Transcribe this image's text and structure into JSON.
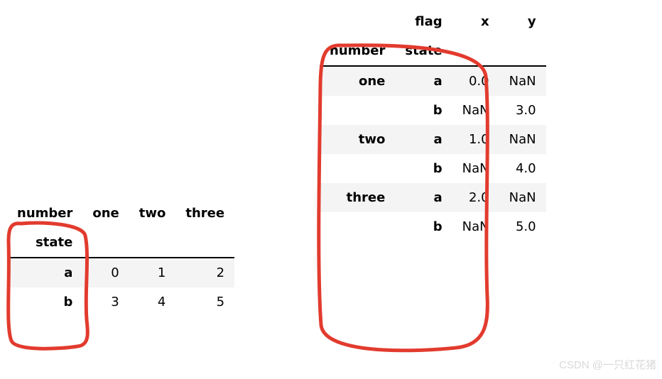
{
  "left_table": {
    "col_index_name": "number",
    "row_index_name": "state",
    "columns": [
      "one",
      "two",
      "three"
    ],
    "rows": [
      {
        "idx": "a",
        "vals": [
          "0",
          "1",
          "2"
        ]
      },
      {
        "idx": "b",
        "vals": [
          "3",
          "4",
          "5"
        ]
      }
    ]
  },
  "right_table": {
    "top_header_name": "flag",
    "columns": [
      "x",
      "y"
    ],
    "row_index_names": [
      "number",
      "state"
    ],
    "rows": [
      {
        "lvl0": "one",
        "lvl1": "a",
        "vals": [
          "0.0",
          "NaN"
        ]
      },
      {
        "lvl0": "",
        "lvl1": "b",
        "vals": [
          "NaN",
          "3.0"
        ]
      },
      {
        "lvl0": "two",
        "lvl1": "a",
        "vals": [
          "1.0",
          "NaN"
        ]
      },
      {
        "lvl0": "",
        "lvl1": "b",
        "vals": [
          "NaN",
          "4.0"
        ]
      },
      {
        "lvl0": "three",
        "lvl1": "a",
        "vals": [
          "2.0",
          "NaN"
        ]
      },
      {
        "lvl0": "",
        "lvl1": "b",
        "vals": [
          "NaN",
          "5.0"
        ]
      }
    ]
  },
  "watermark": "CSDN @一只红花猪",
  "annotation_color": "#e23b2e"
}
